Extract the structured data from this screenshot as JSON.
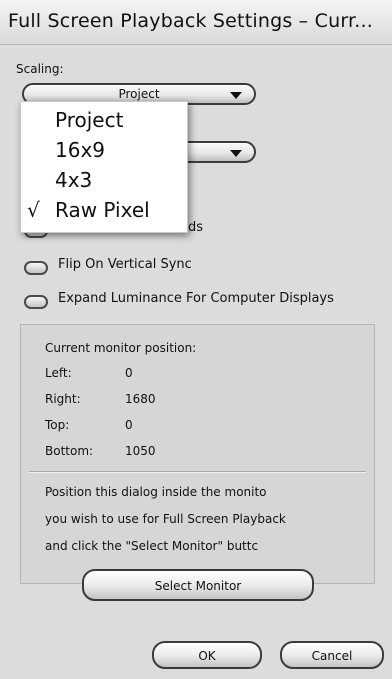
{
  "window": {
    "title": "Full Screen Playback Settings – Curr..."
  },
  "scaling": {
    "label": "Scaling:",
    "selected": "Project",
    "options": [
      "Project",
      "16x9",
      "4x3",
      "Raw Pixel"
    ],
    "checked_option": "Raw Pixel",
    "check_mark": "√"
  },
  "checkboxes": {
    "display_fields_partial": "ds",
    "flip_vertical_sync": "Flip On Vertical Sync",
    "expand_luminance": "Expand Luminance For Computer Displays"
  },
  "monitor": {
    "heading": "Current monitor position:",
    "left_label": "Left:",
    "left_value": "0",
    "right_label": "Right:",
    "right_value": "1680",
    "top_label": "Top:",
    "top_value": "0",
    "bottom_label": "Bottom:",
    "bottom_value": "1050",
    "instructions": [
      "Position this dialog inside the monito",
      "you wish to use for Full Screen Playback",
      "and click the \"Select Monitor\" buttc"
    ],
    "select_button": "Select Monitor"
  },
  "buttons": {
    "ok": "OK",
    "cancel": "Cancel"
  }
}
